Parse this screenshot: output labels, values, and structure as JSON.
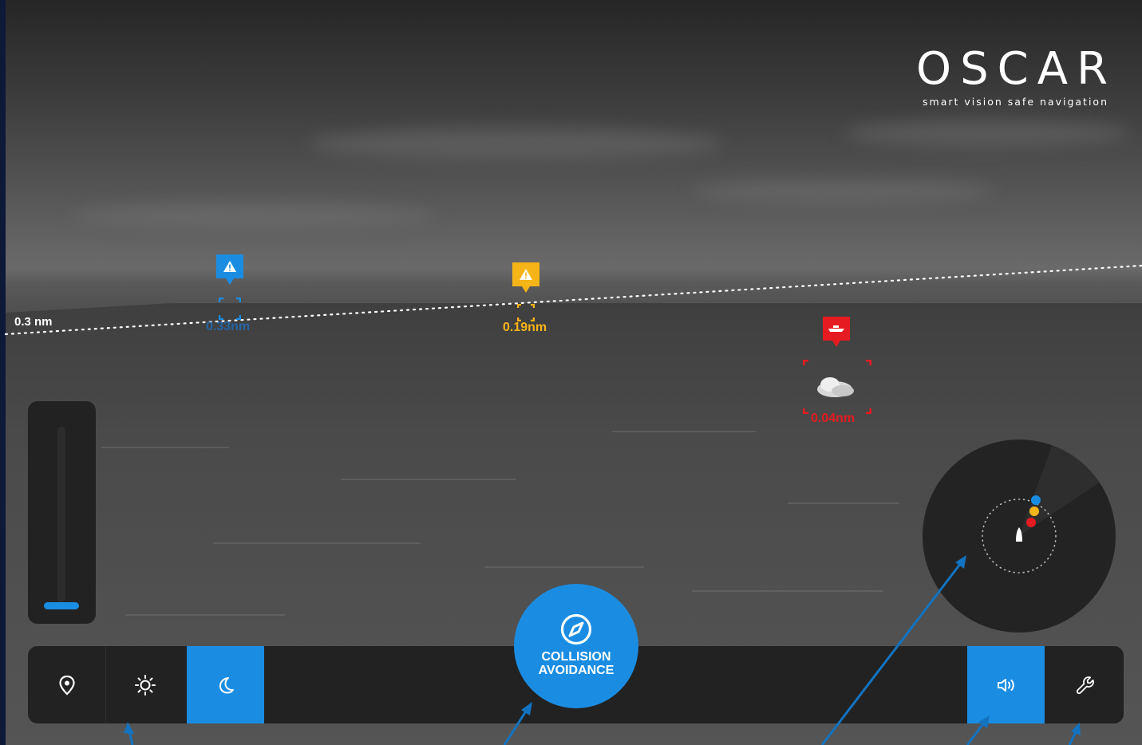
{
  "brand": {
    "name": "OSCAR",
    "tagline": "smart vision safe navigation"
  },
  "horizon": {
    "range_label": "0.3 nm"
  },
  "targets": [
    {
      "id": "hazard-blue",
      "color": "#1a8de3",
      "icon": "warning-icon",
      "range": "0.33nm"
    },
    {
      "id": "hazard-yellow",
      "color": "#f5b417",
      "icon": "warning-icon",
      "range": "0.19nm"
    },
    {
      "id": "vessel-red",
      "color": "#e51b21",
      "icon": "boat-icon",
      "range": "0.04nm"
    }
  ],
  "zoom": {
    "level": 0.0
  },
  "radar": {
    "contacts": [
      "#1a8de3",
      "#f5b417",
      "#e51b21"
    ]
  },
  "toolbar": {
    "left": [
      {
        "name": "location-button",
        "icon": "location-pin-icon",
        "active": false
      },
      {
        "name": "day-mode-button",
        "icon": "sun-icon",
        "active": false
      },
      {
        "name": "night-mode-button",
        "icon": "moon-icon",
        "active": true
      }
    ],
    "center": {
      "icon": "compass-icon",
      "label_line1": "COLLISION",
      "label_line2": "AVOIDANCE"
    },
    "right": [
      {
        "name": "sound-button",
        "icon": "speaker-icon",
        "active": true
      },
      {
        "name": "settings-button",
        "icon": "wrench-icon",
        "active": false
      }
    ]
  },
  "colors": {
    "accent": "#1a8de3",
    "warning": "#f5b417",
    "danger": "#e51b21",
    "panel": "#222222"
  }
}
